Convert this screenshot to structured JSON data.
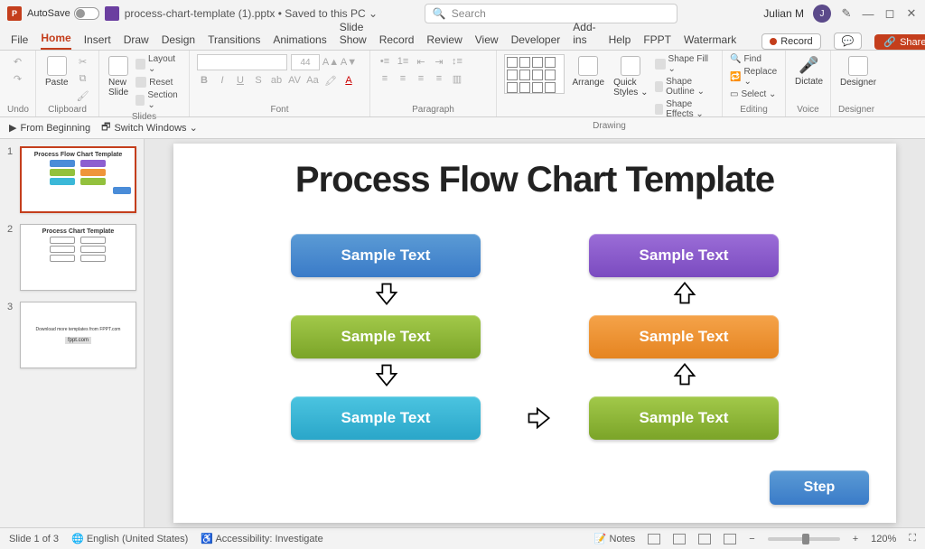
{
  "titlebar": {
    "autosave": "AutoSave",
    "docname": "process-chart-template (1).pptx • Saved to this PC ⌄",
    "search_placeholder": "Search",
    "user": "Julian M",
    "avatar_initial": "J"
  },
  "tabs": {
    "file": "File",
    "home": "Home",
    "insert": "Insert",
    "draw": "Draw",
    "design": "Design",
    "transitions": "Transitions",
    "animations": "Animations",
    "slideshow": "Slide Show",
    "record": "Record",
    "review": "Review",
    "view": "View",
    "developer": "Developer",
    "addins": "Add-ins",
    "help": "Help",
    "fppt": "FPPT",
    "watermark": "Watermark",
    "record_btn": "Record",
    "share": "Share"
  },
  "ribbon": {
    "undo": "Undo",
    "clipboard": "Clipboard",
    "paste": "Paste",
    "slides": "Slides",
    "newslide": "New\nSlide",
    "layout": "Layout ⌄",
    "reset": "Reset",
    "section": "Section ⌄",
    "font": "Font",
    "fontsize": "44",
    "paragraph": "Paragraph",
    "drawing": "Drawing",
    "arrange": "Arrange",
    "quickstyles": "Quick\nStyles ⌄",
    "shapefill": "Shape Fill ⌄",
    "shapeoutline": "Shape Outline ⌄",
    "shapeeffects": "Shape Effects ⌄",
    "editing": "Editing",
    "find": "Find",
    "replace": "Replace ⌄",
    "select": "Select ⌄",
    "voice": "Voice",
    "dictate": "Dictate",
    "designer": "Designer"
  },
  "quickbar": {
    "frombeginning": "From Beginning",
    "switchwindows": "Switch Windows ⌄"
  },
  "thumbs": {
    "t1_title": "Process Flow Chart Template",
    "t2_title": "Process Chart Template",
    "t3_text": "Download more templates from FPPT.com",
    "t3_link": "fppt.com"
  },
  "slide": {
    "title": "Process Flow Chart Template",
    "box1": "Sample Text",
    "box2": "Sample Text",
    "box3": "Sample Text",
    "box4": "Sample Text",
    "box5": "Sample Text",
    "box6": "Sample Text",
    "step": "Step"
  },
  "status": {
    "slide": "Slide 1 of 3",
    "lang": "English (United States)",
    "access": "Accessibility: Investigate",
    "notes": "Notes",
    "zoom": "120%"
  }
}
